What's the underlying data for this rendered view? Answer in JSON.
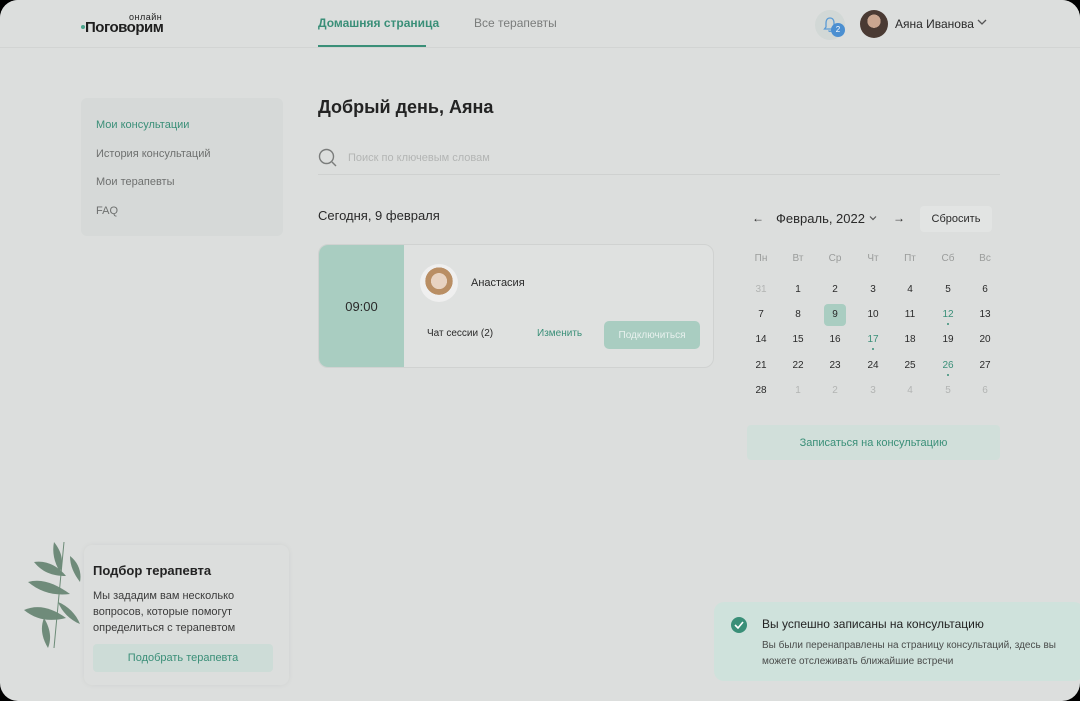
{
  "header": {
    "logo_main": "Поговорим",
    "logo_sup": "онлайн",
    "tabs": [
      {
        "label": "Домашняя страница",
        "active": true
      },
      {
        "label": "Все терапевты",
        "active": false
      }
    ],
    "notification_count": "2",
    "user_name": "Аяна Иванова",
    "icons": {
      "bell": "bell-icon",
      "chevron": "chevron-down-icon",
      "avatar": "user-avatar"
    }
  },
  "sidebar": {
    "items": [
      {
        "label": "Мои консультации",
        "active": true
      },
      {
        "label": "История консультаций",
        "active": false
      },
      {
        "label": "Мои терапевты",
        "active": false
      },
      {
        "label": "FAQ",
        "active": false
      }
    ]
  },
  "main": {
    "greeting": "Добрый день, Аяна",
    "search_placeholder": "Поиск по ключевым словам",
    "today_label": "Сегодня, 9 февраля",
    "session": {
      "time": "09:00",
      "therapist": "Анастасия",
      "chat_label": "Чат сессии (2)",
      "edit_label": "Изменить",
      "connect_label": "Подключиться"
    }
  },
  "calendar": {
    "month_label": "Февраль, 2022",
    "prev": "←",
    "next": "→",
    "reset_label": "Сбросить",
    "weekdays": [
      "Пн",
      "Вт",
      "Ср",
      "Чт",
      "Пт",
      "Сб",
      "Вс"
    ],
    "weeks": [
      [
        "31",
        "1",
        "2",
        "3",
        "4",
        "5",
        "6"
      ],
      [
        "7",
        "8",
        "9",
        "10",
        "11",
        "12",
        "13"
      ],
      [
        "14",
        "15",
        "16",
        "17",
        "18",
        "19",
        "20"
      ],
      [
        "21",
        "22",
        "23",
        "24",
        "25",
        "26",
        "27"
      ],
      [
        "28",
        "1",
        "2",
        "3",
        "4",
        "5",
        "6"
      ]
    ],
    "selected_day": "9",
    "marked_days": [
      "12",
      "17",
      "26"
    ],
    "book_label": "Записаться на консультацию"
  },
  "therapist_pick": {
    "title": "Подбор терапевта",
    "text": "Мы зададим вам несколько вопросов, которые помогут определиться с терапевтом",
    "button": "Подобрать терапевта"
  },
  "toast": {
    "title": "Вы успешно записаны на консультацию",
    "body": "Вы были перенаправлены на страницу консультаций, здесь вы можете отслеживать ближайшие встречи"
  },
  "colors": {
    "accent": "#3a8f78",
    "accent_light": "#a9cdc1",
    "background": "#dcdedd"
  }
}
